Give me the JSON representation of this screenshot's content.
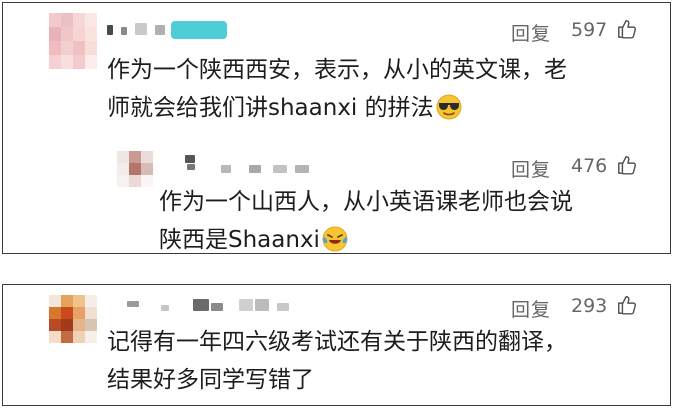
{
  "comments": [
    {
      "text_line1": "作为一个陕西西安，表示，从小的英文课，老",
      "text_line2": "师就会给我们讲shaanxi 的拼法",
      "reply_label": "回复",
      "likes": "597",
      "emoji": "sunglasses-emoji"
    },
    {
      "text_line1": "作为一个山西人，从小英语课老师也会说",
      "text_line2": "陕西是Shaanxi",
      "reply_label": "回复",
      "likes": "476",
      "emoji": "laughing-crying-emoji"
    },
    {
      "text_line1": "记得有一年四六级考试还有关于陕西的翻译，",
      "text_line2": "结果好多同学写错了",
      "reply_label": "回复",
      "likes": "293"
    }
  ],
  "colors": {
    "text": "#1d1d1d",
    "meta": "#666666",
    "border": "#3a3a3a",
    "blur_teal": "#2fc4cf"
  }
}
